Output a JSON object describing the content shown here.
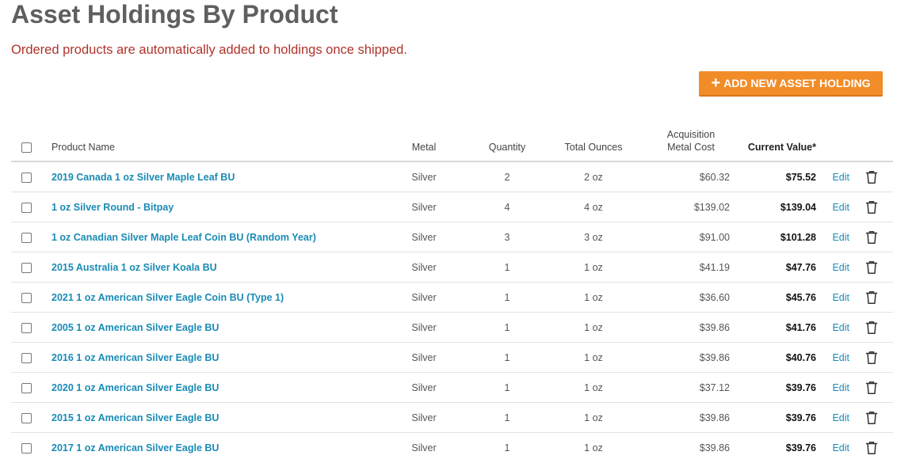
{
  "page": {
    "title": "Asset Holdings By Product",
    "notice": "Ordered products are automatically added to holdings once shipped."
  },
  "toolbar": {
    "add_icon": "+",
    "add_label": "ADD NEW ASSET HOLDING"
  },
  "table": {
    "headers": {
      "product_name": "Product Name",
      "metal": "Metal",
      "quantity": "Quantity",
      "total_ounces": "Total Ounces",
      "acquisition_line1": "Acquisition",
      "acquisition_line2": "Metal Cost",
      "current_value": "Current Value*"
    },
    "edit_label": "Edit",
    "delete_icon": "trash-icon",
    "rows": [
      {
        "name": "2019 Canada 1 oz Silver Maple Leaf BU",
        "metal": "Silver",
        "qty": "2",
        "oz": "2 oz",
        "cost": "$60.32",
        "value": "$75.52"
      },
      {
        "name": "1 oz Silver Round - Bitpay",
        "metal": "Silver",
        "qty": "4",
        "oz": "4 oz",
        "cost": "$139.02",
        "value": "$139.04"
      },
      {
        "name": "1 oz Canadian Silver Maple Leaf Coin BU (Random Year)",
        "metal": "Silver",
        "qty": "3",
        "oz": "3 oz",
        "cost": "$91.00",
        "value": "$101.28"
      },
      {
        "name": "2015 Australia 1 oz Silver Koala BU",
        "metal": "Silver",
        "qty": "1",
        "oz": "1 oz",
        "cost": "$41.19",
        "value": "$47.76"
      },
      {
        "name": "2021 1 oz American Silver Eagle Coin BU (Type 1)",
        "metal": "Silver",
        "qty": "1",
        "oz": "1 oz",
        "cost": "$36.60",
        "value": "$45.76"
      },
      {
        "name": "2005 1 oz American Silver Eagle BU",
        "metal": "Silver",
        "qty": "1",
        "oz": "1 oz",
        "cost": "$39.86",
        "value": "$41.76"
      },
      {
        "name": "2016 1 oz American Silver Eagle BU",
        "metal": "Silver",
        "qty": "1",
        "oz": "1 oz",
        "cost": "$39.86",
        "value": "$40.76"
      },
      {
        "name": "2020 1 oz American Silver Eagle BU",
        "metal": "Silver",
        "qty": "1",
        "oz": "1 oz",
        "cost": "$37.12",
        "value": "$39.76"
      },
      {
        "name": "2015 1 oz American Silver Eagle BU",
        "metal": "Silver",
        "qty": "1",
        "oz": "1 oz",
        "cost": "$39.86",
        "value": "$39.76"
      },
      {
        "name": "2017 1 oz American Silver Eagle BU",
        "metal": "Silver",
        "qty": "1",
        "oz": "1 oz",
        "cost": "$39.86",
        "value": "$39.76"
      }
    ]
  },
  "colors": {
    "title": "#5f5f5f",
    "notice": "#b0332a",
    "accent_button": "#f28c28",
    "link": "#1a8bb5"
  }
}
